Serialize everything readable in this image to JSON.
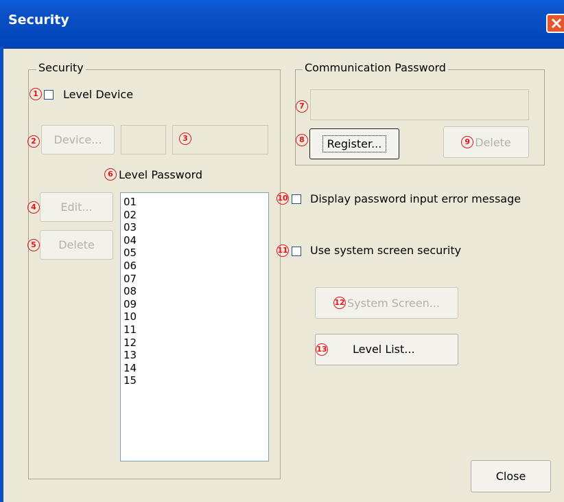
{
  "window": {
    "title": "Security"
  },
  "security_group": {
    "label": "Security",
    "level_device_label": "Level Device",
    "device_button": "Device...",
    "level_password_label": "Level Password",
    "edit_button": "Edit...",
    "delete_button": "Delete",
    "level_list": [
      "01",
      "02",
      "03",
      "04",
      "05",
      "06",
      "07",
      "08",
      "09",
      "10",
      "11",
      "12",
      "13",
      "14",
      "15"
    ]
  },
  "comm_group": {
    "label": "Communication Password",
    "register_button": "Register...",
    "delete_button": "Delete"
  },
  "options": {
    "display_error_label": "Display password input error message",
    "system_security_label": "Use system screen security"
  },
  "buttons": {
    "system_screen": "System Screen...",
    "level_list": "Level List...",
    "close": "Close"
  },
  "markers": {
    "m1": "1",
    "m2": "2",
    "m3": "3",
    "m4": "4",
    "m5": "5",
    "m6": "6",
    "m7": "7",
    "m8": "8",
    "m9": "9",
    "m10": "10",
    "m11": "11",
    "m12": "12",
    "m13": "13"
  },
  "colors": {
    "titlebar": "#0b4fc4",
    "dialog_bg": "#ece9d8",
    "marker": "#e0141e",
    "close_button": "#e5562d"
  }
}
